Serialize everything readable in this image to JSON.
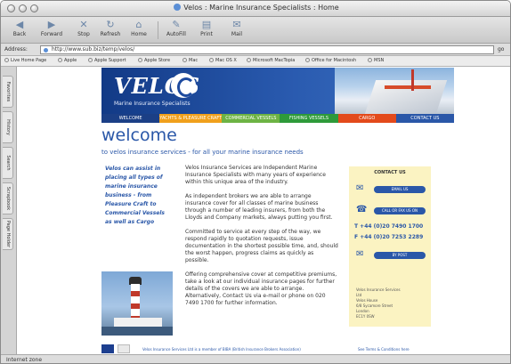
{
  "window": {
    "title": "Velos : Marine Insurance Specialists : Home"
  },
  "toolbar": {
    "buttons": [
      {
        "label": "Back",
        "icon": "back-arrow-icon"
      },
      {
        "label": "Forward",
        "icon": "forward-arrow-icon"
      },
      {
        "label": "Stop",
        "icon": "stop-icon"
      },
      {
        "label": "Refresh",
        "icon": "refresh-icon"
      },
      {
        "label": "Home",
        "icon": "home-icon"
      },
      {
        "label": "AutoFill",
        "icon": "autofill-icon"
      },
      {
        "label": "Print",
        "icon": "print-icon"
      },
      {
        "label": "Mail",
        "icon": "mail-icon"
      }
    ]
  },
  "address": {
    "label": "Address:",
    "url": "http://www.sub.biz/temp/velos/",
    "go_label": "go"
  },
  "favorites": [
    "Live Home Page",
    "Apple",
    "Apple Support",
    "Apple Store",
    "Mac",
    "Mac OS X",
    "Microsoft MacTopia",
    "Office for Macintosh",
    "MSN"
  ],
  "side_tabs": [
    "Favorites",
    "History",
    "Search",
    "Scrapbook",
    "Page Holder"
  ],
  "status": {
    "text": "Internet zone"
  },
  "site": {
    "logo": "VELOS",
    "tagline": "Marine Insurance Specialists",
    "nav": [
      {
        "label": "WELCOME",
        "color": "#1b3f86"
      },
      {
        "label": "YACHTS & PLEASURE CRAFT",
        "color": "#f0a01c"
      },
      {
        "label": "COMMERCIAL VESSELS",
        "color": "#6db344"
      },
      {
        "label": "FISHING VESSELS",
        "color": "#2e9a3a"
      },
      {
        "label": "CARGO",
        "color": "#e34a1b"
      },
      {
        "label": "CONTACT US",
        "color": "#2a57a8"
      }
    ],
    "heading": "welcome",
    "subheading": "to velos insurance services - for all your marine insurance needs",
    "left_copy": "Velos can assist in placing all types of marine insurance business - from Pleasure Craft to Commercial Vessels as well as Cargo",
    "paragraphs": [
      "Velos Insurance Services are Independent Marine Insurance Specialists with many years of experience within this unique area of the industry.",
      "As independent brokers we are able to arrange insurance cover for all classes of marine business through a number of leading insurers, from both the Lloyds and Company markets, always putting you first.",
      "Committed to service at every step of the way, we respond rapidly to quotation requests, issue documentation in the shortest possible time, and, should the worst happen, progress claims as quickly as possible.",
      "Offering comprehensive cover at competitive premiums, take a look at our individual insurance pages for further details of the covers we are able to arrange. Alternatively, Contact Us via e-mail or phone on 020 7490 1700 for further information."
    ],
    "contact": {
      "title": "CONTACT US",
      "email_btn": "EMAIL US",
      "callback_btn": "CALL OR FAX US ON",
      "tel": "T +44 (0)20 7490 1700",
      "fax": "F +44 (0)20 7253 2289",
      "visit_btn": "BY POST",
      "address_lines": [
        "Velos Insurance Services",
        "Ltd",
        "Velos House",
        "6/8 Sycamore Street",
        "London",
        "EC1Y 0SW"
      ]
    },
    "footer": {
      "member_text": "Velos Insurance Services Ltd is a member of BIBA (British Insurance Brokers Association)",
      "terms": "See Terms & Conditions here"
    }
  }
}
